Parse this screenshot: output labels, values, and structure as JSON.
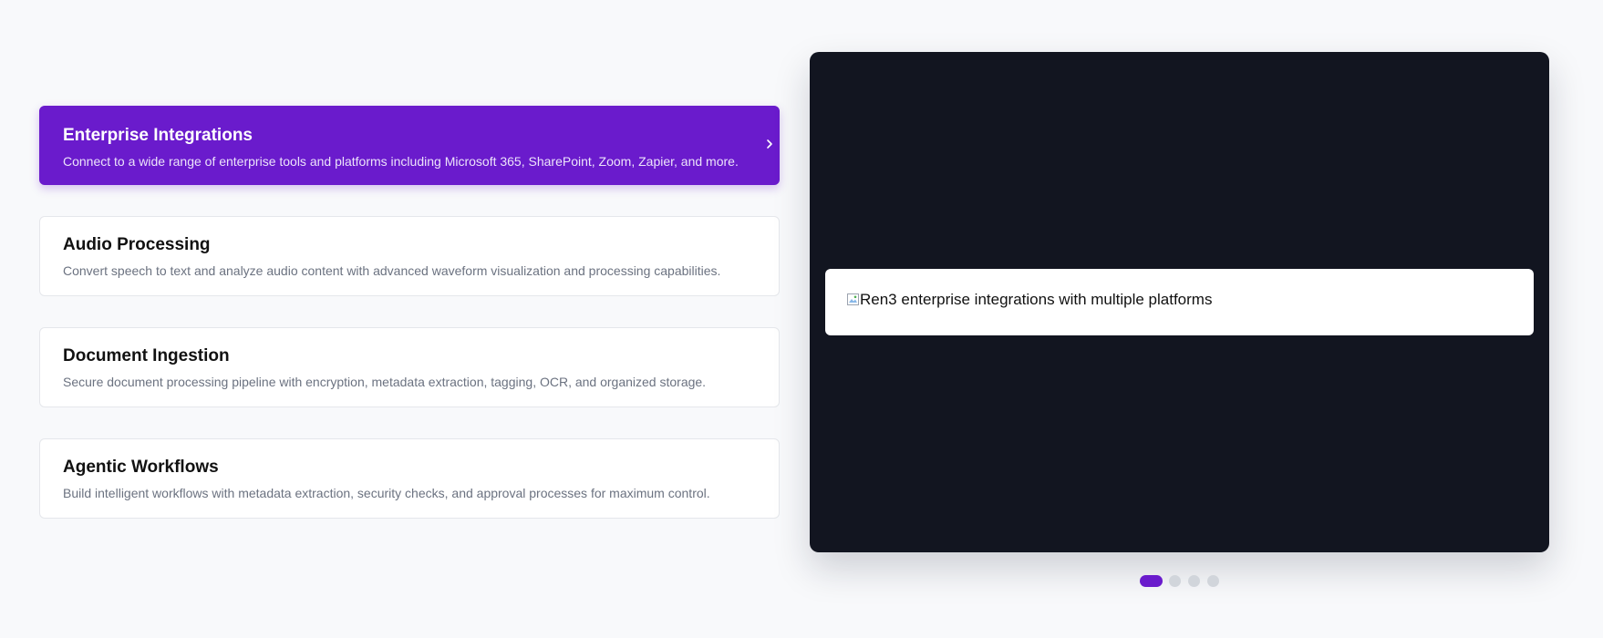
{
  "features": [
    {
      "title": "Enterprise Integrations",
      "description": "Connect to a wide range of enterprise tools and platforms including Microsoft 365, SharePoint, Zoom, Zapier, and more."
    },
    {
      "title": "Audio Processing",
      "description": "Convert speech to text and analyze audio content with advanced waveform visualization and processing capabilities."
    },
    {
      "title": "Document Ingestion",
      "description": "Secure document processing pipeline with encryption, metadata extraction, tagging, OCR, and organized storage."
    },
    {
      "title": "Agentic Workflows",
      "description": "Build intelligent workflows with metadata extraction, security checks, and approval processes for maximum control."
    }
  ],
  "active_feature_index": 0,
  "preview": {
    "image_alt": "Ren3 enterprise integrations with multiple platforms"
  },
  "carousel": {
    "slide_count": 4,
    "active_slide": 1
  },
  "colors": {
    "accent": "#6a1bcc",
    "panel_background": "#121520",
    "page_background": "#f8f9fb",
    "inactive_dot": "#d1d5db"
  },
  "icons": {
    "active_card_indicator": "chevron-right-icon",
    "image_placeholder": "broken-image-icon"
  }
}
